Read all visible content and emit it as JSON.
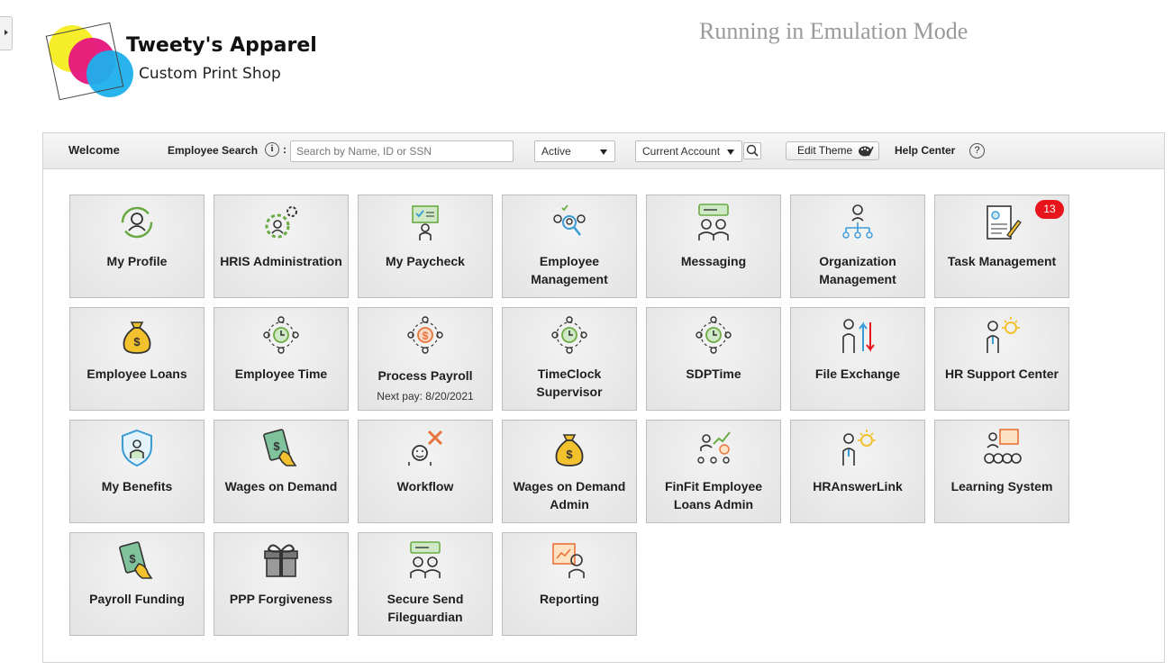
{
  "brand": {
    "title": "Tweety's Apparel",
    "subtitle": "Custom Print Shop"
  },
  "emulation_text": "Running in Emulation Mode",
  "toolbar": {
    "welcome": "Welcome",
    "employee_search_label": "Employee Search",
    "info_icon": "i",
    "colon": ":",
    "search_placeholder": "Search by Name, ID or SSN",
    "status_select": "Active",
    "account_select": "Current Account",
    "edit_theme": "Edit Theme",
    "help_center": "Help Center",
    "help_icon": "?"
  },
  "colors": {
    "badge": "#e8141c",
    "icon_green": "#6aab45",
    "icon_blue": "#3a9bd5",
    "icon_gold": "#f2c12e"
  },
  "tiles": [
    {
      "label": "My Profile",
      "icon": "profile-refresh-icon"
    },
    {
      "label": "HRIS Administration",
      "icon": "gear-person-icon"
    },
    {
      "label": "My Paycheck",
      "icon": "paycheck-icon"
    },
    {
      "label": "Employee Management",
      "icon": "employee-search-icon"
    },
    {
      "label": "Messaging",
      "icon": "messaging-icon"
    },
    {
      "label": "Organization Management",
      "icon": "org-chart-icon"
    },
    {
      "label": "Task Management",
      "icon": "task-document-icon",
      "badge": "13"
    },
    {
      "label": "Employee Loans",
      "icon": "money-bag-icon"
    },
    {
      "label": "Employee Time",
      "icon": "clock-people-icon"
    },
    {
      "label": "Process Payroll",
      "icon": "payroll-cycle-icon",
      "sub": "Next pay: 8/20/2021"
    },
    {
      "label": "TimeClock Supervisor",
      "icon": "clock-people-icon"
    },
    {
      "label": "SDPTime",
      "icon": "clock-people-icon"
    },
    {
      "label": "File Exchange",
      "icon": "file-exchange-icon"
    },
    {
      "label": "HR Support Center",
      "icon": "idea-person-icon"
    },
    {
      "label": "My Benefits",
      "icon": "shield-person-icon"
    },
    {
      "label": "Wages on Demand",
      "icon": "cash-hand-icon"
    },
    {
      "label": "Workflow",
      "icon": "workflow-tools-icon"
    },
    {
      "label": "Wages on Demand Admin",
      "icon": "money-bag-icon"
    },
    {
      "label": "FinFit Employee Loans Admin",
      "icon": "growth-chart-icon"
    },
    {
      "label": "HRAnswerLink",
      "icon": "idea-person-icon"
    },
    {
      "label": "Learning System",
      "icon": "presentation-icon"
    },
    {
      "label": "Payroll Funding",
      "icon": "cash-hand-icon"
    },
    {
      "label": "PPP Forgiveness",
      "icon": "gift-icon"
    },
    {
      "label": "Secure Send Fileguardian",
      "icon": "messaging-icon"
    },
    {
      "label": "Reporting",
      "icon": "report-board-icon"
    }
  ]
}
